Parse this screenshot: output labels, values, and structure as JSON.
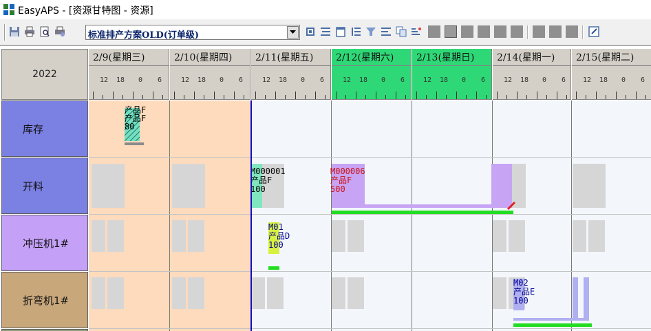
{
  "window": {
    "title": "EasyAPS - [资源甘特图 - 资源]"
  },
  "toolbar": {
    "plan_selector": {
      "value": "标准排产方案OLD(订单级)"
    },
    "icons": [
      "save-icon",
      "print-icon",
      "print-preview-icon",
      "page-setup-icon",
      "refresh-icon",
      "list-icon",
      "calendar-icon",
      "indent-icon",
      "filter-icon",
      "align-icon",
      "copy-icon",
      "sort-icon",
      "edit-icon"
    ]
  },
  "gantt": {
    "year": "2022",
    "days": [
      {
        "label": "2/9(星期三)",
        "weekend": false
      },
      {
        "label": "2/10(星期四)",
        "weekend": false
      },
      {
        "label": "2/11(星期五)",
        "weekend": false
      },
      {
        "label": "2/12(星期六)",
        "weekend": true
      },
      {
        "label": "2/13(星期日)",
        "weekend": true
      },
      {
        "label": "2/14(星期一)",
        "weekend": false
      },
      {
        "label": "2/15(星期二)",
        "weekend": false
      }
    ],
    "hour_ticks": [
      "12",
      "18",
      "0",
      "6"
    ],
    "resources": [
      "库存",
      "开料",
      "冲压机1#",
      "折弯机1#"
    ],
    "tasks": {
      "inventory": {
        "line1": "产品F",
        "line2": "产品F",
        "line3": "80"
      },
      "cut_m000001": {
        "order": "M000001",
        "product": "产品F",
        "qty": "100"
      },
      "cut_m000006": {
        "order": "M000006",
        "product": "产品F",
        "qty": "500"
      },
      "press_m01": {
        "order": "M01",
        "product": "产品D",
        "qty": "100"
      },
      "bend_m02": {
        "order": "M02",
        "product": "产品E",
        "qty": "100"
      }
    }
  },
  "colors": {
    "weekend_header": "#2fd876",
    "peach_background": "#fedbbd",
    "row_label_blue": "#7b80e3",
    "row_label_purple": "#c4a0f7",
    "row_label_tan": "#c8a77b",
    "progress_green": "#22dd22",
    "today_line": "#1010c0"
  }
}
